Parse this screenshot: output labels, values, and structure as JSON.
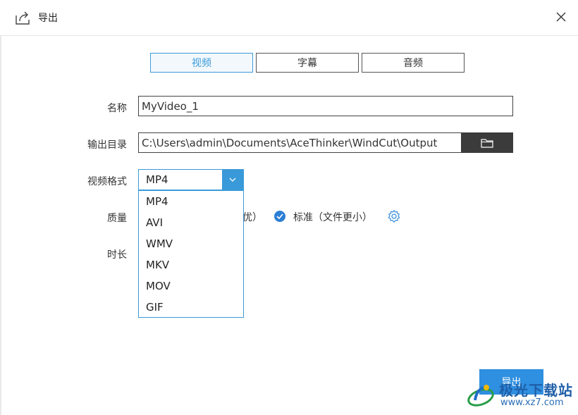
{
  "dialog": {
    "title": "导出"
  },
  "tabs": [
    {
      "label": "视频",
      "active": true
    },
    {
      "label": "字幕",
      "active": false
    },
    {
      "label": "音频",
      "active": false
    }
  ],
  "form": {
    "name_label": "名称",
    "name_value": "MyVideo_1",
    "output_label": "输出目录",
    "output_value": "C:\\Users\\admin\\Documents\\AceThinker\\WindCut\\Output",
    "format_label": "视频格式",
    "format_value": "MP4",
    "quality_label": "质量",
    "quality_partial": "优）",
    "quality_standard": "标准（文件更小）",
    "duration_label": "时长"
  },
  "format_options": [
    "MP4",
    "AVI",
    "WMV",
    "MKV",
    "MOV",
    "GIF"
  ],
  "export_button": "导出",
  "watermark": {
    "text": "极光下载站",
    "url": "www.xz7.com"
  },
  "colors": {
    "accent": "#3a9ad9",
    "button": "#2f8fe0",
    "folder_button": "#3b3b3b"
  }
}
